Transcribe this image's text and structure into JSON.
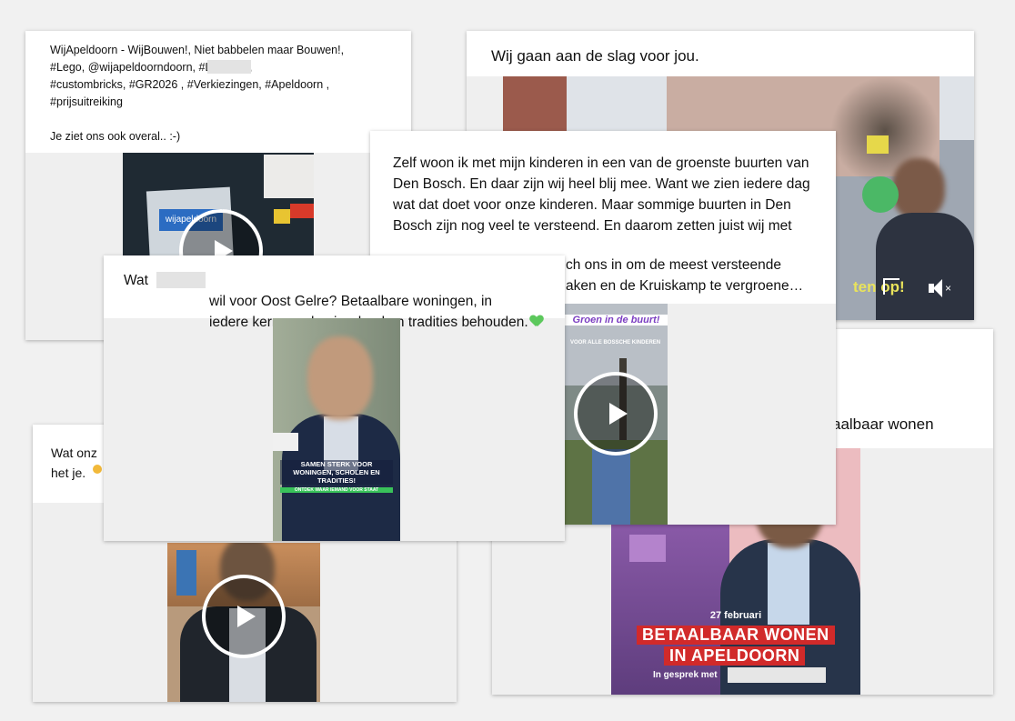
{
  "cards": {
    "lego": {
      "caption": "WijApeldoorn - WijBouwen!, Niet babbelen maar Bouwen!,\n#Lego, @wijapeldoorndoorn,          #LegoCity,\n#custombricks, #GR2026 , #Verkiezingen, #Apeldoorn ,\n#prijsuitreiking\n\nJe ziet ons ook overal.. :-)",
      "sign_text": "wijapeldoorn"
    },
    "slag": {
      "caption": "Wij gaan aan de slag voor jou.",
      "overlay_text": "ten op!"
    },
    "denbosch": {
      "caption": "Zelf woon ik met mijn kinderen in een van de groenste buurten van Den Bosch. En daar zijn wij heel blij mee. Want we zien iedere dag wat dat doet voor onze kinderen. Maar sommige buurten in Den Bosch zijn nog veel te versteend. En daarom zetten juist wij met",
      "caption_tail1": "ch ons in om de meest versteende",
      "caption_tail2": "aken en de Kruiskamp te vergroene…",
      "video_title": "Groen in de buurt!",
      "video_subtitle": "VOOR ALLE BOSSCHE KINDEREN"
    },
    "oostgelre": {
      "caption_start": "Wat",
      "caption_rest": "wil voor Oost Gelre? Betaalbare woningen, in\niedere kern een basisschool en tradities behouden.",
      "banner": "SAMEN STERK VOOR\nWONINGEN, SCHOLEN EN\nTRADITIES!",
      "banner_sub": "ONTDEK WAAR IEMAND VOOR STAAT"
    },
    "wonen": {
      "caption": "aalbaar wonen",
      "date": "27 februari",
      "line1": "BETAALBAAR WONEN",
      "line2": "IN APELDOORN",
      "line3": "In gesprek met"
    },
    "onze": {
      "caption": "Wat onz\nhet je."
    }
  },
  "colors": {
    "heart": "#5cc85c",
    "banner_red": "#d12a2a",
    "green_bar": "#39c25a",
    "purple_title": "#7c3fc2"
  }
}
